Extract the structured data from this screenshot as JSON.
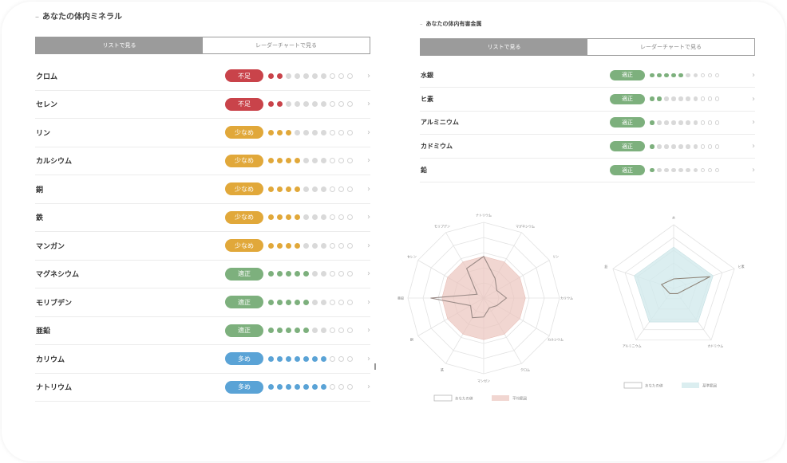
{
  "colors": {
    "deficient": "#c9434a",
    "low": "#e1a83a",
    "adequate": "#7db07d",
    "high": "#5aa3d6",
    "empty": "#d9d9d9"
  },
  "minerals": {
    "title": "あなたの体内ミネラル",
    "tabs": [
      "リストで見る",
      "レーダーチャートで見る"
    ],
    "items": [
      {
        "name": "クロム",
        "status": "不足",
        "level": "deficient",
        "filled": 2
      },
      {
        "name": "セレン",
        "status": "不足",
        "level": "deficient",
        "filled": 2
      },
      {
        "name": "リン",
        "status": "少なめ",
        "level": "low",
        "filled": 3
      },
      {
        "name": "カルシウム",
        "status": "少なめ",
        "level": "low",
        "filled": 4
      },
      {
        "name": "銅",
        "status": "少なめ",
        "level": "low",
        "filled": 4
      },
      {
        "name": "鉄",
        "status": "少なめ",
        "level": "low",
        "filled": 4
      },
      {
        "name": "マンガン",
        "status": "少なめ",
        "level": "low",
        "filled": 4
      },
      {
        "name": "マグネシウム",
        "status": "適正",
        "level": "adequate",
        "filled": 5
      },
      {
        "name": "モリブデン",
        "status": "適正",
        "level": "adequate",
        "filled": 5
      },
      {
        "name": "亜鉛",
        "status": "適正",
        "level": "adequate",
        "filled": 5
      },
      {
        "name": "カリウム",
        "status": "多め",
        "level": "high",
        "filled": 7
      },
      {
        "name": "ナトリウム",
        "status": "多め",
        "level": "high",
        "filled": 7
      }
    ]
  },
  "heavy_metals": {
    "title": "あなたの体内有害金属",
    "tabs": [
      "リストで見る",
      "レーダーチャートで見る"
    ],
    "items": [
      {
        "name": "水銀",
        "status": "適正",
        "level": "adequate",
        "filled": 5
      },
      {
        "name": "ヒ素",
        "status": "適正",
        "level": "adequate",
        "filled": 2
      },
      {
        "name": "アルミニウム",
        "status": "適正",
        "level": "adequate",
        "filled": 1
      },
      {
        "name": "カドミウム",
        "status": "適正",
        "level": "adequate",
        "filled": 1
      },
      {
        "name": "鉛",
        "status": "適正",
        "level": "adequate",
        "filled": 1
      }
    ]
  },
  "radar_minerals": {
    "axes": [
      "ナトリウム",
      "マグネシウム",
      "リン",
      "カリウム",
      "カルシウム",
      "クロム",
      "マンガン",
      "鉄",
      "銅",
      "亜鉛",
      "セレン",
      "モリブデン"
    ],
    "values": [
      0.55,
      0.3,
      0.2,
      0.3,
      0.2,
      0.15,
      0.25,
      0.3,
      0.2,
      0.7,
      0.1,
      0.45
    ],
    "reference": [
      0.55,
      0.55,
      0.55,
      0.55,
      0.55,
      0.55,
      0.55,
      0.55,
      0.55,
      0.55,
      0.55,
      0.55
    ],
    "legend": [
      "あなたの値",
      "平均範囲"
    ]
  },
  "radar_metals": {
    "axes": [
      "水",
      "ヒ素",
      "カドミウム",
      "アルミニウム",
      "鉛"
    ],
    "values": [
      0.15,
      0.6,
      0.1,
      0.1,
      0.2
    ],
    "reference": [
      0.65,
      0.65,
      0.65,
      0.65,
      0.65
    ],
    "legend": [
      "あなたの値",
      "基準範囲"
    ]
  }
}
